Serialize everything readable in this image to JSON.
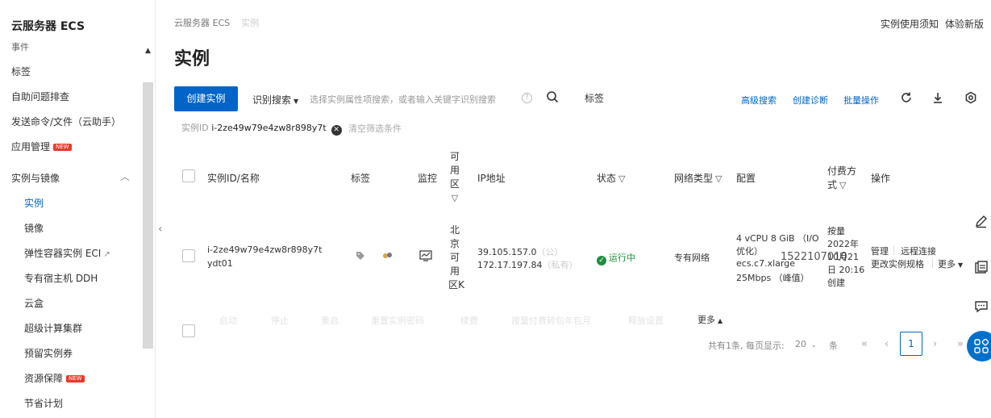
{
  "sidebar": {
    "title": "云服务器 ECS",
    "cut_item": "事件",
    "items": [
      {
        "label": "标签"
      },
      {
        "label": "自助问题排查"
      },
      {
        "label": "发送命令/文件（云助手）"
      },
      {
        "label": "应用管理",
        "badge": "NEW"
      },
      {
        "label": "实例与镜像"
      }
    ],
    "sub_items": [
      {
        "label": "实例",
        "active": true
      },
      {
        "label": "镜像"
      },
      {
        "label": "弹性容器实例 ECI"
      },
      {
        "label": "专有宿主机 DDH"
      },
      {
        "label": "云盒"
      },
      {
        "label": "超级计算集群"
      },
      {
        "label": "预留实例券"
      },
      {
        "label": "资源保障",
        "badge": "NEW"
      },
      {
        "label": "节省计划"
      }
    ]
  },
  "header": {
    "breadcrumb": "云服务器 ECS",
    "breadcrumb_faint": "实例",
    "notice": "实例使用须知",
    "new_version": "体验新版",
    "title": "实例"
  },
  "toolbar": {
    "create_label": "创建实例",
    "filter_label": "识别搜索",
    "search_placeholder": "选择实例属性项搜索，或者输入关键字识别搜索",
    "help_glyph": "?",
    "tag_label": "标签",
    "advanced_search": "高级搜索",
    "create_diagnosis": "创建诊断",
    "batch_ops": "批量操作"
  },
  "filter_chip": {
    "key": "实例ID",
    "value": "i-2ze49w79e4zw8r898y7t",
    "clear_label": "清空筛选条件"
  },
  "table": {
    "headers": {
      "id_name": "实例ID/名称",
      "tags": "标签",
      "monitor": "监控",
      "zone_chars": [
        "可",
        "用",
        "区"
      ],
      "ip": "IP地址",
      "status": "状态",
      "network": "网络类型",
      "config": "配置",
      "billing_1": "付费方",
      "billing_2": "式",
      "actions": "操作"
    },
    "rows": [
      {
        "id": "i-2ze49w79e4zw8r898y7t",
        "name": "ydt01",
        "zone_chars": [
          "北",
          "京",
          "可",
          "用",
          "区K"
        ],
        "ip_public": "39.105.157.0",
        "ip_public_tag": "（公）",
        "ip_private": "172.17.197.84",
        "ip_private_tag": "（私有）",
        "status": "运行中",
        "network": "专有网络",
        "config_line1": "4 vCPU 8 GiB （I/O",
        "config_line2": "优化）",
        "instance_type": "ecs.c7.xlarge",
        "bandwidth": "25Mbps （峰值）",
        "billing_line1": "按量",
        "billing_line2": "2022年",
        "billing_line3": "10月21",
        "billing_line4": "日 20:16",
        "billing_line5": "创建",
        "action_manage": "管理",
        "action_remote": "远程连接",
        "action_resize": "更改实例规格",
        "action_more": "更多"
      }
    ],
    "watermark": "1522107010",
    "batch_actions": [
      "启动",
      "停止",
      "重启",
      "重置实例密码",
      "续费",
      "按量付费转包年包月",
      "释放设置"
    ],
    "batch_more": "更多"
  },
  "pagination": {
    "info": "共有1条, 每页显示:",
    "page_size": "20",
    "unit": "条",
    "first": "«",
    "prev": "‹",
    "current": "1",
    "next": "›",
    "last": "»"
  },
  "colors": {
    "primary": "#0064c8",
    "running": "#1e8e3e",
    "badge_new": "#e8392c"
  }
}
